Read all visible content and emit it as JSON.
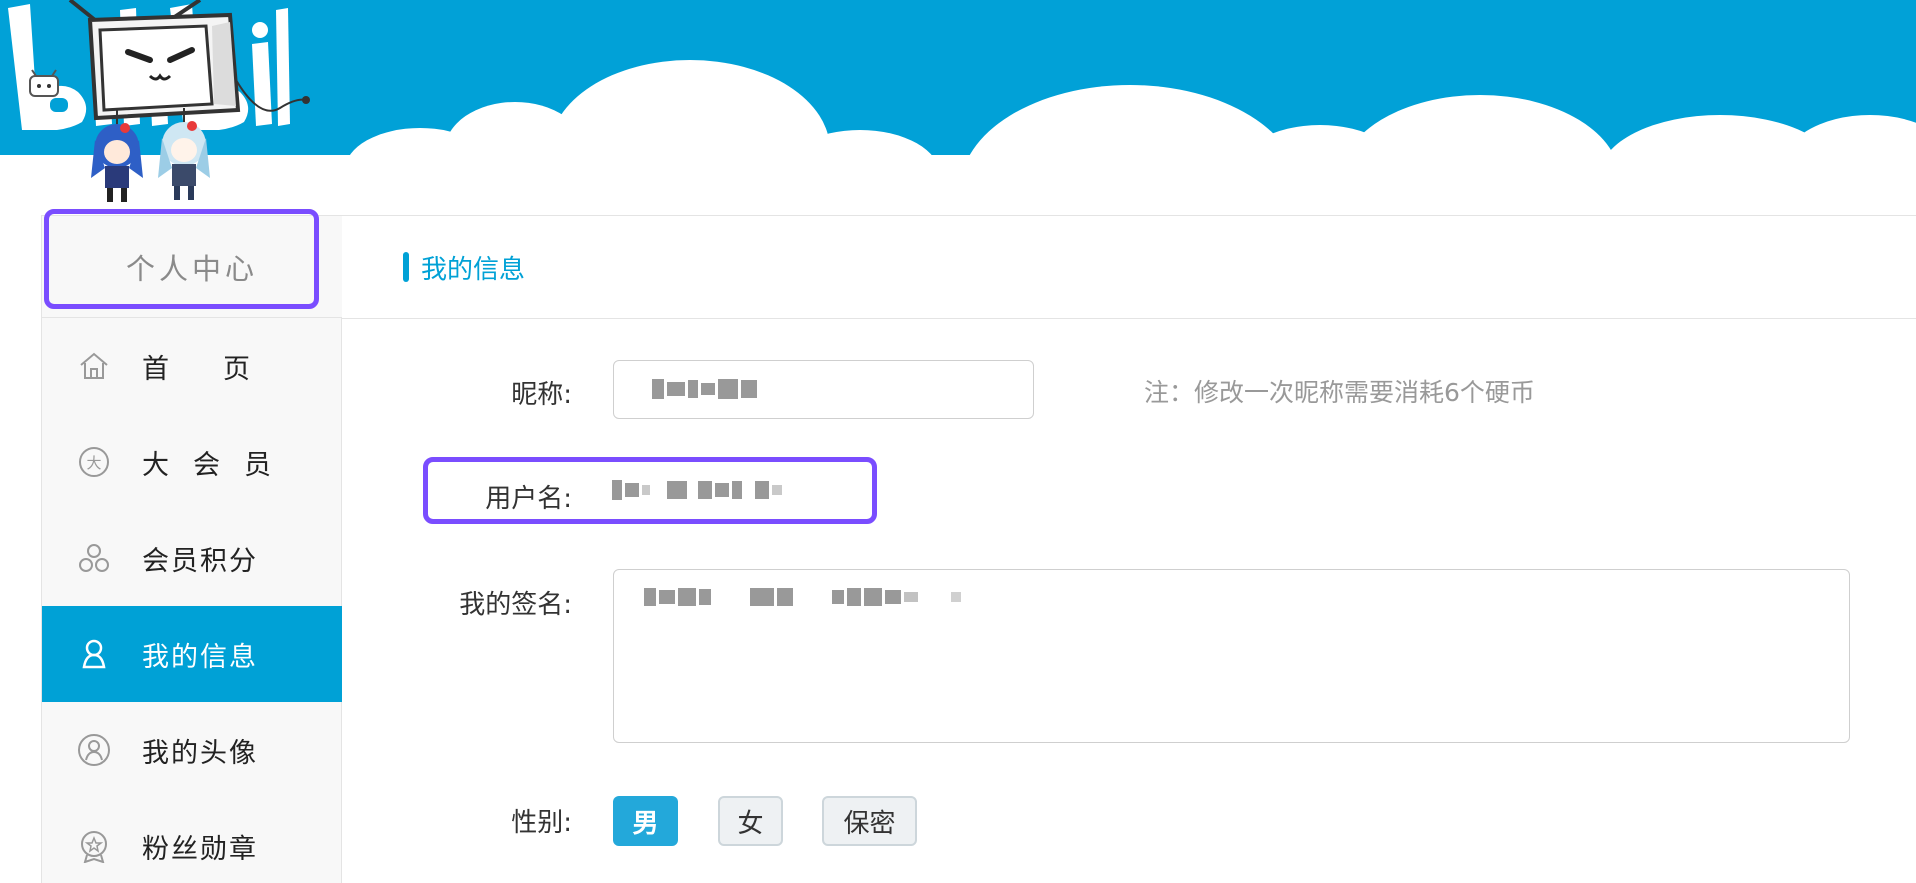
{
  "brand": {
    "logo_text": "bilibili"
  },
  "sidebar": {
    "title": "个人中心",
    "items": [
      {
        "label": "首页",
        "icon": "home-icon",
        "active": false
      },
      {
        "label": "大会员",
        "icon": "vip-icon",
        "active": false
      },
      {
        "label": "会员积分",
        "icon": "points-icon",
        "active": false
      },
      {
        "label": "我的信息",
        "icon": "user-icon",
        "active": true
      },
      {
        "label": "我的头像",
        "icon": "avatar-icon",
        "active": false
      },
      {
        "label": "粉丝勋章",
        "icon": "medal-icon",
        "active": false
      }
    ]
  },
  "section": {
    "title": "我的信息"
  },
  "form": {
    "nickname": {
      "label": "昵称:",
      "note": "注：修改一次昵称需要消耗6个硬币"
    },
    "username": {
      "label": "用户名:"
    },
    "signature": {
      "label": "我的签名:"
    },
    "gender": {
      "label": "性别:",
      "options": [
        "男",
        "女",
        "保密"
      ],
      "selected": "男"
    }
  },
  "colors": {
    "brand_blue": "#00a1d6",
    "highlight": "#7a4dff"
  }
}
